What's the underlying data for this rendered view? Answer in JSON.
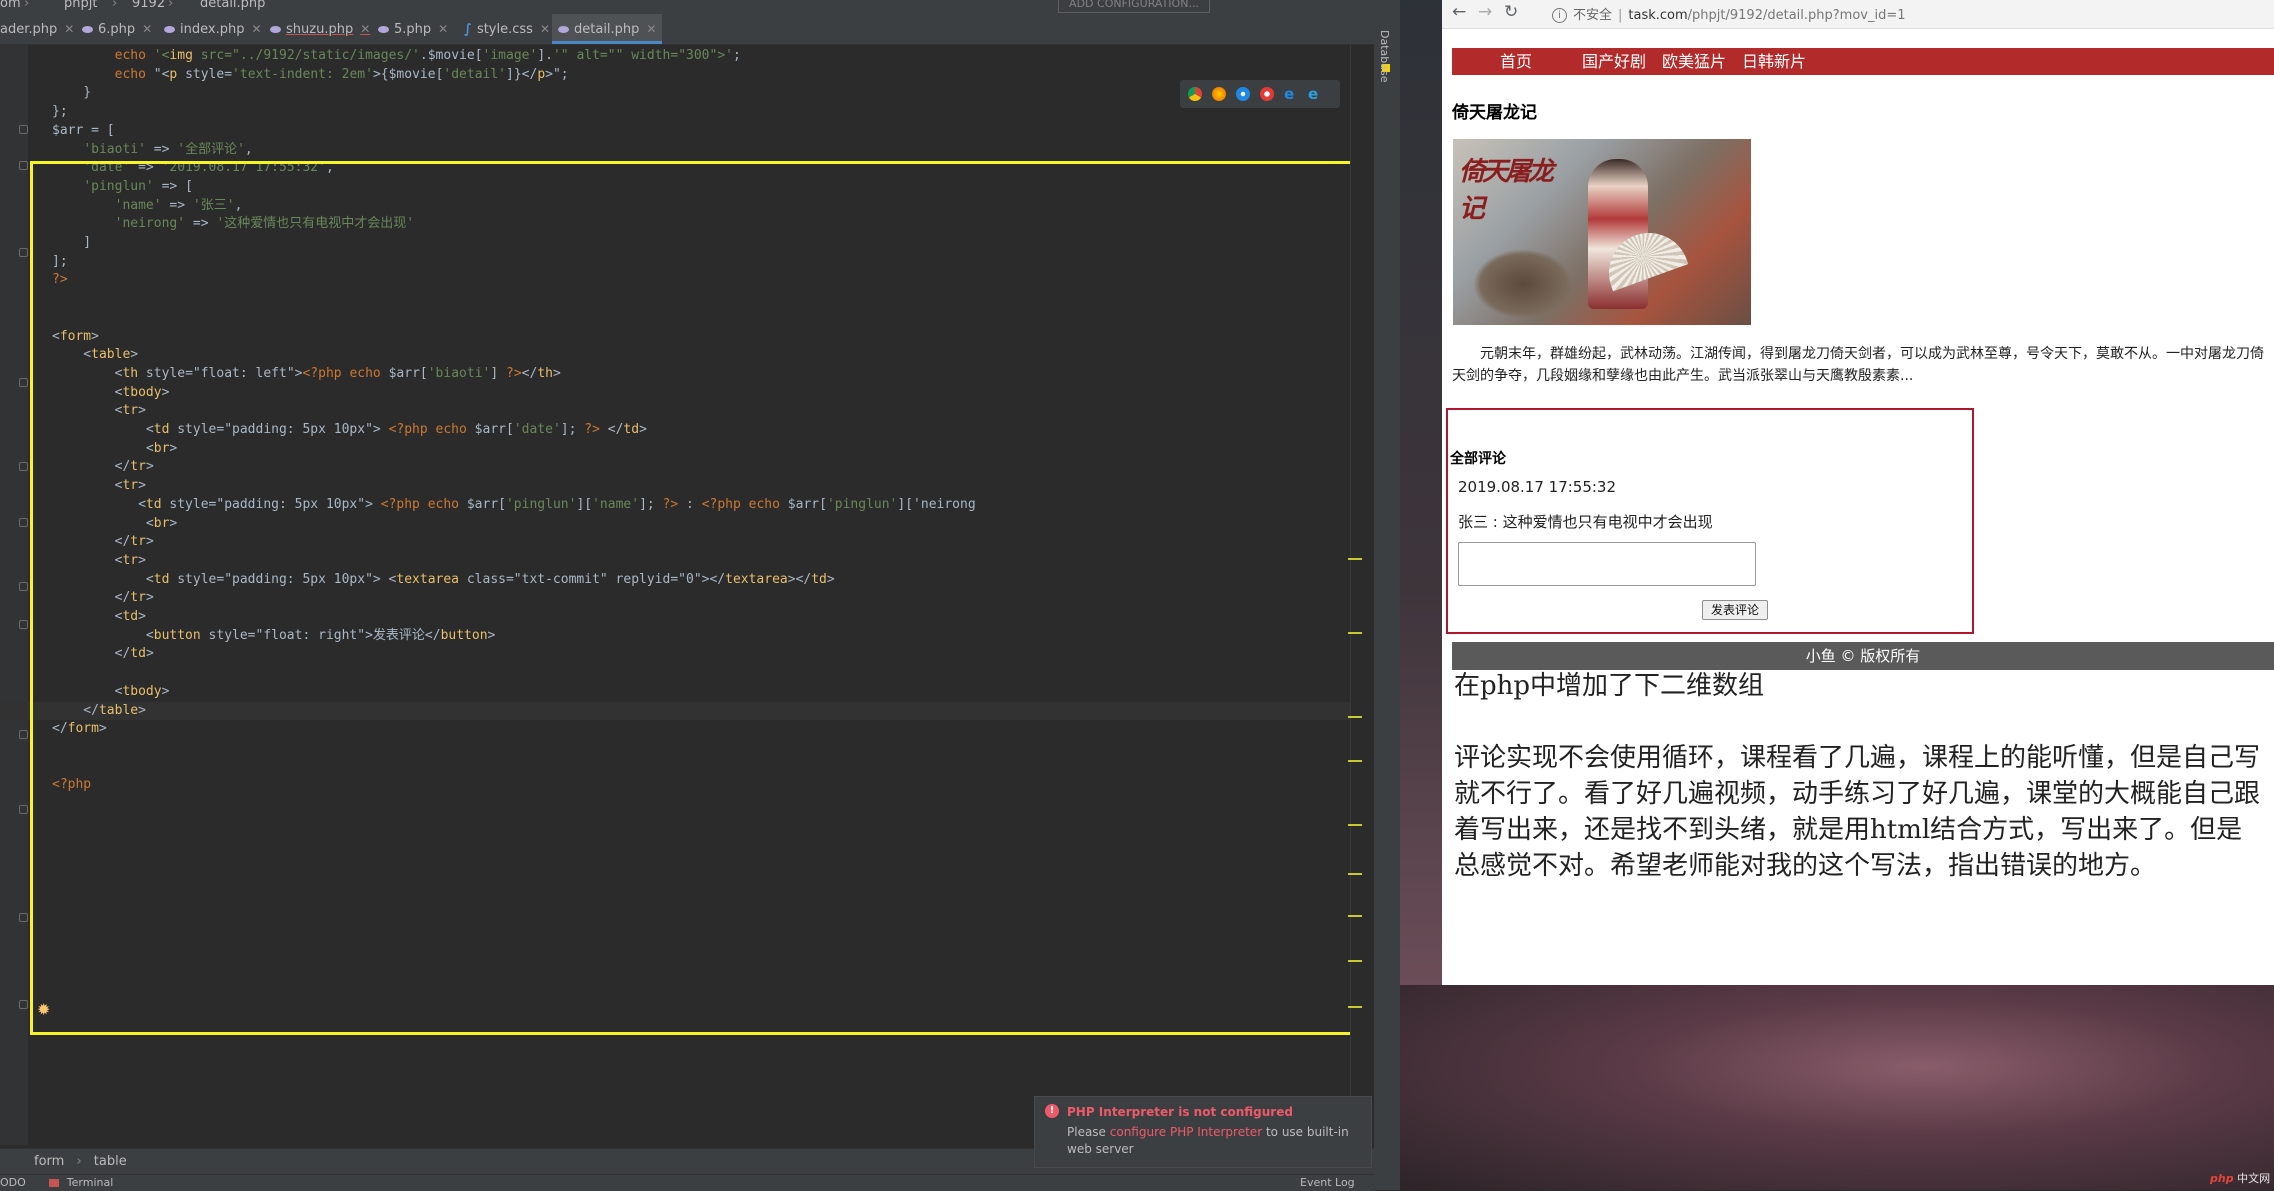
{
  "ide": {
    "breadcrumb_top": [
      "om",
      "phpjt",
      "9192",
      "detail.php"
    ],
    "config_button": "ADD CONFIGURATION...",
    "tabs": [
      {
        "label": "ader.php",
        "icon": "php"
      },
      {
        "label": "6.php",
        "icon": "php"
      },
      {
        "label": "index.php",
        "icon": "php"
      },
      {
        "label": "shuzu.php",
        "icon": "php"
      },
      {
        "label": "5.php",
        "icon": "php"
      },
      {
        "label": "style.css",
        "icon": "css"
      },
      {
        "label": "detail.php",
        "icon": "php"
      }
    ],
    "side_label": "Database",
    "code_lines": [
      "        echo '<img src=\"../9192/static/images/'.$movie['image'].'\" alt=\"\" width=\"300\">';",
      "        echo \"<p style='text-indent: 2em'>{$movie['detail']}</p>\";",
      "    }",
      "};",
      "$arr = [",
      "    'biaoti' => '全部评论',",
      "    'date' => '2019.08.17 17:55:32',",
      "    'pinglun' => [",
      "        'name' => '张三',",
      "        'neirong' => '这种爱情也只有电视中才会出现'",
      "    ]",
      "];",
      "?>",
      "",
      "",
      "<form>",
      "    <table>",
      "        <th style=\"float: left\"><?php echo $arr['biaoti'] ?></th>",
      "        <tbody>",
      "        <tr>",
      "            <td style=\"padding: 5px 10px\"> <?php echo $arr['date']; ?> </td>",
      "            <br>",
      "        </tr>",
      "        <tr>",
      "           <td style=\"padding: 5px 10px\"> <?php echo $arr['pinglun']['name']; ?> : <?php echo $arr['pinglun']['neirong",
      "            <br>",
      "        </tr>",
      "        <tr>",
      "            <td style=\"padding: 5px 10px\"> <textarea class=\"txt-commit\" replyid=\"0\"></textarea></td>",
      "        </tr>",
      "        <td>",
      "            <button style=\"float: right\">发表评论</button>",
      "        </td>",
      "",
      "        <tbody>",
      "    </table>",
      "</form>",
      "",
      "",
      "<?php"
    ],
    "code_breadcrumb": [
      "form",
      "table"
    ],
    "status_left": [
      "ODO",
      "Terminal"
    ],
    "status_right": "Event Log",
    "notification": {
      "title": "PHP Interpreter is not configured",
      "text_before": "Please ",
      "link": "configure PHP Interpreter",
      "text_after": " to use built-in web server"
    }
  },
  "browser": {
    "insecure": "不安全",
    "url_host": "task.com",
    "url_path": "/phpjt/9192/detail.php?mov_id=1",
    "nav": [
      "首页",
      "国产好剧",
      "欧美猛片",
      "日韩新片"
    ],
    "movie_title": "倚天屠龙记",
    "poster_logo": "倚天屠龙记",
    "description": "元朝末年，群雄纷起，武林动荡。江湖传闻，得到屠龙刀倚天剑者，可以成为武林至尊，号令天下，莫敢不从。一中对屠龙刀倚天剑的争夺，几段姻缘和孽缘也由此产生。武当派张翠山与天鹰教殷素素...",
    "comments": {
      "title": "全部评论",
      "date": "2019.08.17 17:55:32",
      "line": "张三 : 这种爱情也只有电视中才会出现",
      "button": "发表评论"
    },
    "footer": "小鱼 © 版权所有",
    "question": [
      "在php中增加了下二维数组",
      "评论实现不会使用循环，课程看了几遍，课程上的能听懂，但是自己写就不行了。看了好几遍视频，动手练习了好几遍，课堂的大概能自己跟着写出来，还是找不到头绪，就是用html结合方式，写出来了。但是总感觉不对。希望老师能对我的这个写法，指出错误的地方。"
    ]
  },
  "watermark": {
    "brand": "php",
    "site": "中文网"
  },
  "colors": {
    "highlight_box": "#f5f32a",
    "nav_bar": "#b22a2a",
    "comment_border": "#b0182f",
    "ide_bg": "#2b2b2b"
  }
}
